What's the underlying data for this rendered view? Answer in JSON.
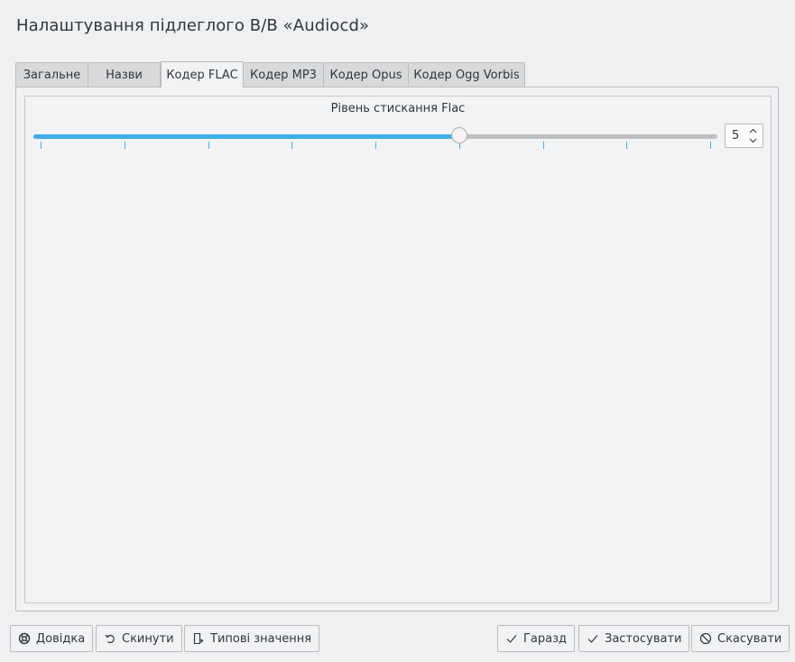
{
  "window": {
    "title": "Налаштування підлеглого В/В «Audiocd»"
  },
  "tabs": [
    {
      "label": "Загальне",
      "active": false
    },
    {
      "label": "Назви",
      "active": false
    },
    {
      "label": "Кодер FLAC",
      "active": true
    },
    {
      "label": "Кодер MP3",
      "active": false
    },
    {
      "label": "Кодер Opus",
      "active": false
    },
    {
      "label": "Кодер Ogg Vorbis",
      "active": false
    }
  ],
  "flac": {
    "compression_label": "Рівень стискання Flac",
    "slider": {
      "min": 0,
      "max": 8,
      "value": 5
    },
    "spin_value": "5"
  },
  "buttons": {
    "help": "Довідка",
    "reset": "Скинути",
    "defaults": "Типові значення",
    "ok": "Гаразд",
    "apply": "Застосувати",
    "cancel": "Скасувати"
  },
  "icons": {
    "help": "help-lifebuoy-icon",
    "reset": "undo-arrow-icon",
    "defaults": "document-defaults-icon",
    "ok": "checkmark-icon",
    "apply": "checkmark-icon",
    "cancel": "cancel-circle-icon"
  },
  "colors": {
    "accent": "#3daee9",
    "window_bg": "#eff0f1",
    "text": "#31363b"
  }
}
